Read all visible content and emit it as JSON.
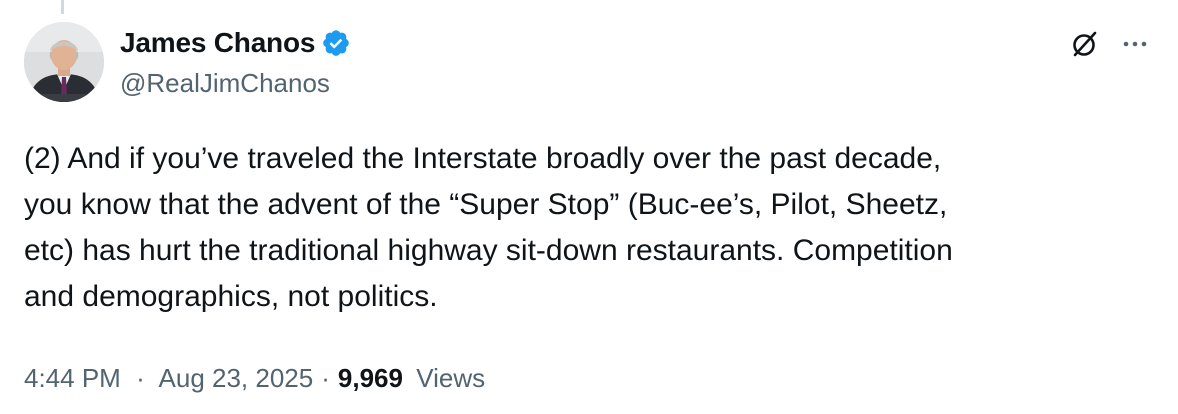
{
  "tweet": {
    "author": {
      "display_name": "James Chanos",
      "handle": "@RealJimChanos",
      "verified": true
    },
    "text": "(2) And if you’ve traveled the Interstate broadly over the past decade,\nyou know that the advent of the “Super Stop” (Buc-ee’s, Pilot, Sheetz,\netc) has hurt the traditional highway sit-down restaurants. Competition\nand demographics, not politics.",
    "time": "4:44 PM",
    "date": "Aug 23, 2025",
    "separator": "·",
    "views_count": "9,969",
    "views_label": "Views"
  },
  "icons": {
    "verified": "verified-badge-icon",
    "grok": "grok-icon",
    "more": "more-icon"
  },
  "colors": {
    "verified_blue": "#1d9bf0",
    "secondary_text": "#536471",
    "primary_text": "#0f1419"
  }
}
